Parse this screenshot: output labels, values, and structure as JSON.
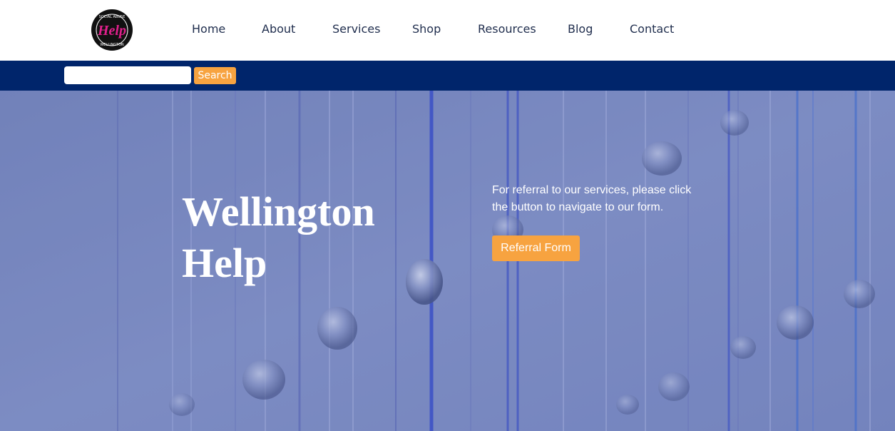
{
  "header": {
    "logo": {
      "text": "Help",
      "ring_text_top": "SOCIAL ABUSE",
      "ring_text_bottom": "WELLINGTON",
      "colors": {
        "ring": "#111111",
        "text": "#e0208c"
      }
    },
    "nav": [
      {
        "label": "Home"
      },
      {
        "label": "About"
      },
      {
        "label": "Services"
      },
      {
        "label": "Shop"
      },
      {
        "label": "Resources"
      },
      {
        "label": "Blog"
      },
      {
        "label": "Contact"
      }
    ]
  },
  "search": {
    "placeholder": "",
    "value": "",
    "button_label": "Search"
  },
  "hero": {
    "title": "Wellington Help",
    "text": "For referral to our services, please click the button to navigate to our form.",
    "button_label": "Referral Form",
    "background_description_icon": "hanging-glass-drops-image"
  },
  "colors": {
    "navy": "#00256b",
    "accent_orange": "#f7a340",
    "nav_text": "#1f2d4d",
    "hero_overlay": "#7989bd"
  }
}
